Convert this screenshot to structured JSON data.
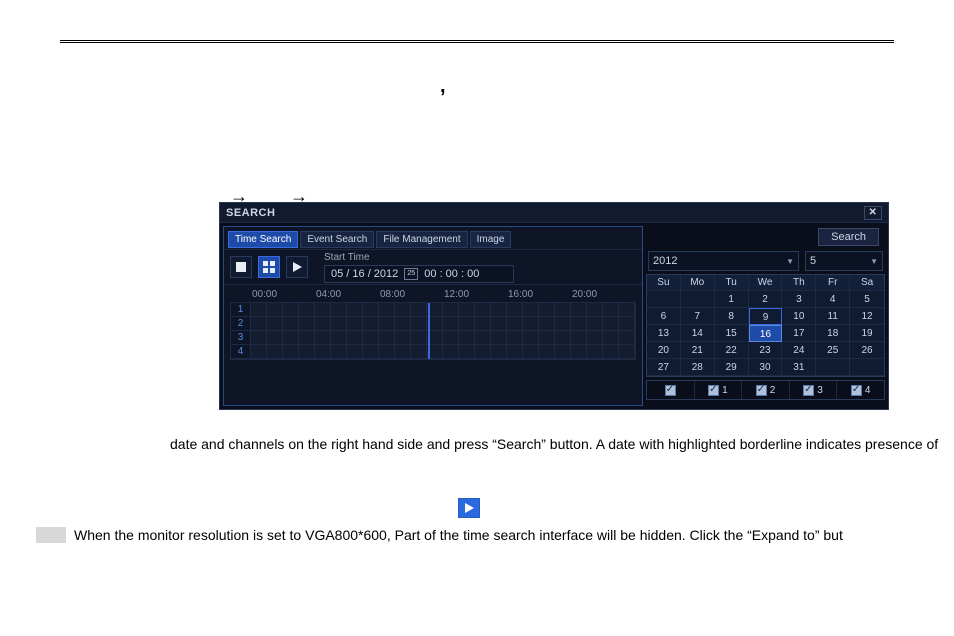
{
  "window": {
    "title": "SEARCH",
    "tabs": [
      "Time Search",
      "Event Search",
      "File Management",
      "Image"
    ],
    "active_tab": 0,
    "search_label": "Search",
    "start_time_label": "Start Time",
    "start_date": "05 / 16 / 2012",
    "start_time": "00 : 00 : 00",
    "timeline_hours": [
      "00:00",
      "04:00",
      "08:00",
      "12:00",
      "16:00",
      "20:00"
    ],
    "channels": [
      "1",
      "2",
      "3",
      "4"
    ],
    "now_position_pct": 46
  },
  "calendar": {
    "year": "2012",
    "month": "5",
    "weekdays": [
      "Su",
      "Mo",
      "Tu",
      "We",
      "Th",
      "Fr",
      "Sa"
    ],
    "weeks": [
      [
        "",
        "",
        "1",
        "2",
        "3",
        "4",
        "5"
      ],
      [
        "6",
        "7",
        "8",
        "9",
        "10",
        "11",
        "12"
      ],
      [
        "13",
        "14",
        "15",
        "16",
        "17",
        "18",
        "19"
      ],
      [
        "20",
        "21",
        "22",
        "23",
        "24",
        "25",
        "26"
      ],
      [
        "27",
        "28",
        "29",
        "30",
        "31",
        "",
        ""
      ]
    ],
    "has_record": [
      "9"
    ],
    "selected": "16"
  },
  "channel_select": {
    "all_checked": true,
    "items": [
      {
        "label": "1",
        "checked": true
      },
      {
        "label": "2",
        "checked": true
      },
      {
        "label": "3",
        "checked": true
      },
      {
        "label": "4",
        "checked": true
      }
    ]
  },
  "doc": {
    "caption1": "date and channels on the right hand side and press “Search” button. A date with highlighted borderline indicates presence of",
    "caption2": "When the monitor resolution is set to VGA800*600, Part of the time search interface will be hidden. Click the “Expand to” but"
  }
}
